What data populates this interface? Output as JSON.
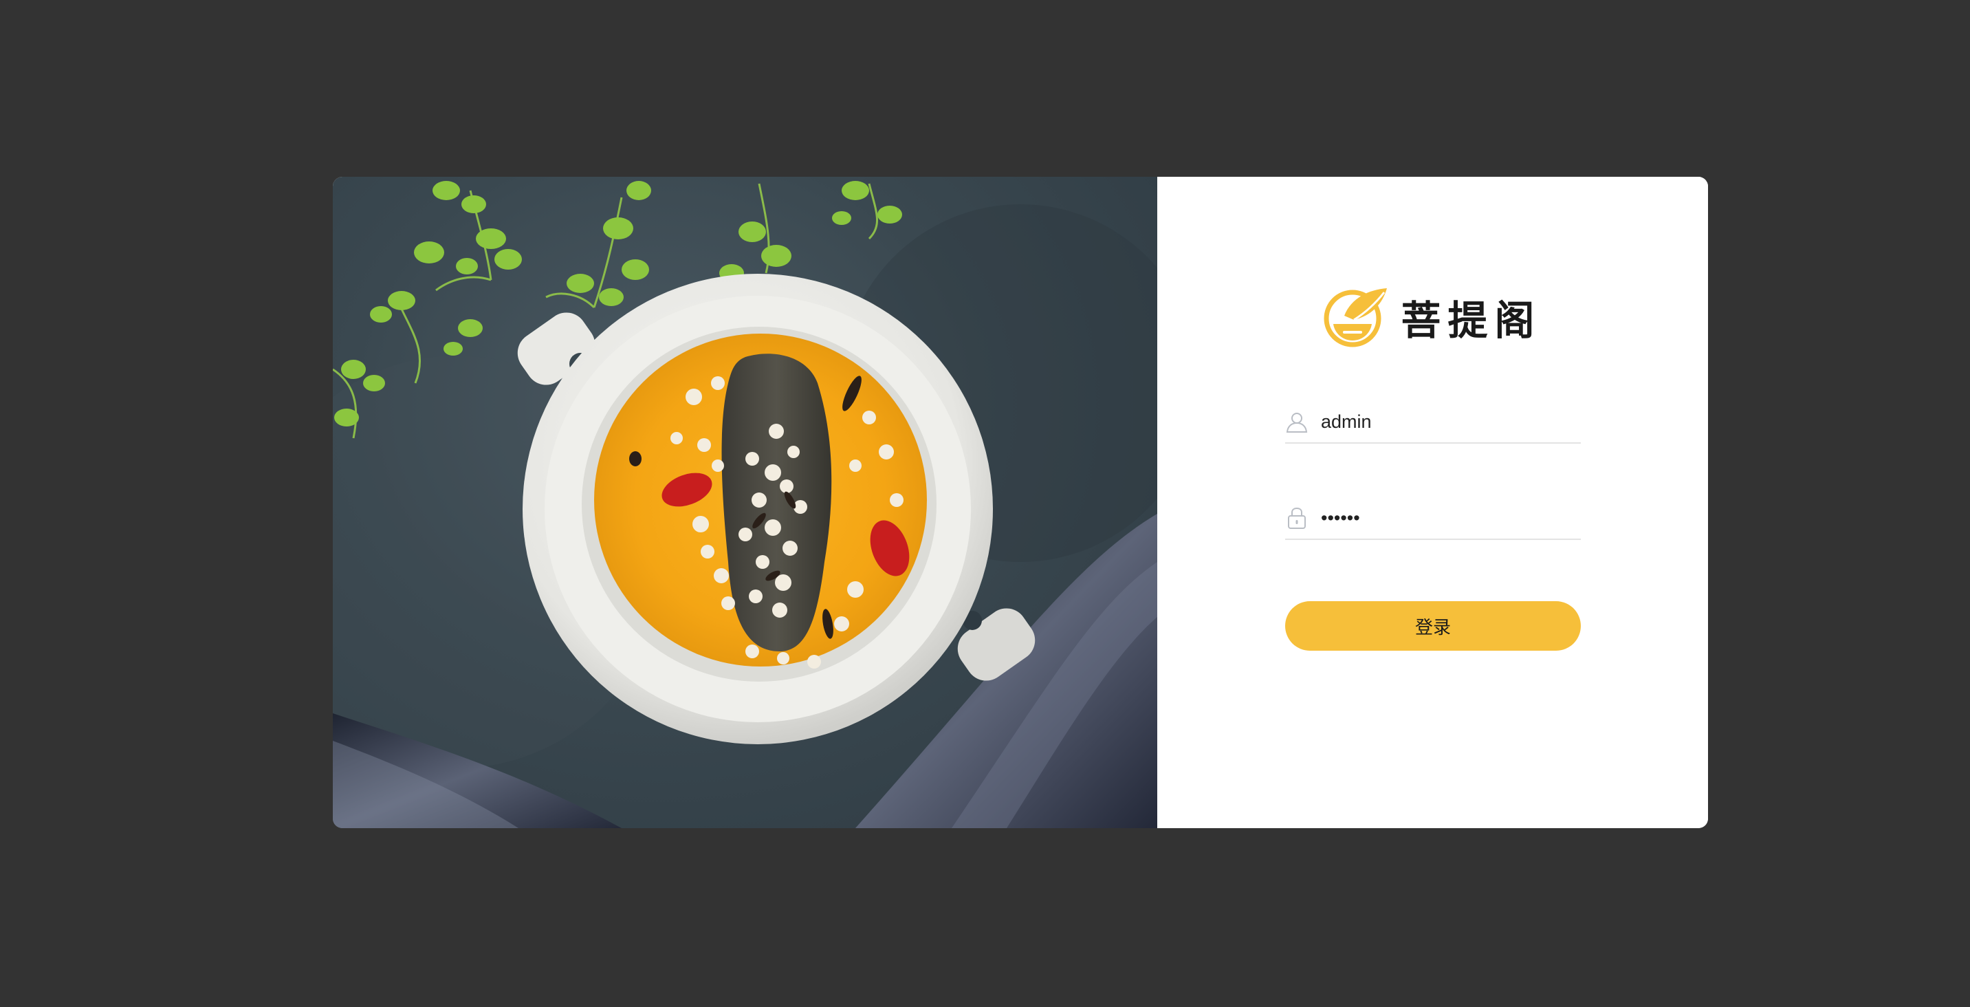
{
  "brand": {
    "name": "菩提阁",
    "logo_icon": "leaf-bowl-logo-icon",
    "accent_color": "#f6bf3a"
  },
  "login_form": {
    "username": {
      "icon": "user-icon",
      "value": "admin"
    },
    "password": {
      "icon": "lock-icon",
      "value": "••••••"
    },
    "submit_label": "登录"
  },
  "colors": {
    "background": "#333333",
    "card": "#ffffff",
    "button": "#f6bf3a"
  }
}
